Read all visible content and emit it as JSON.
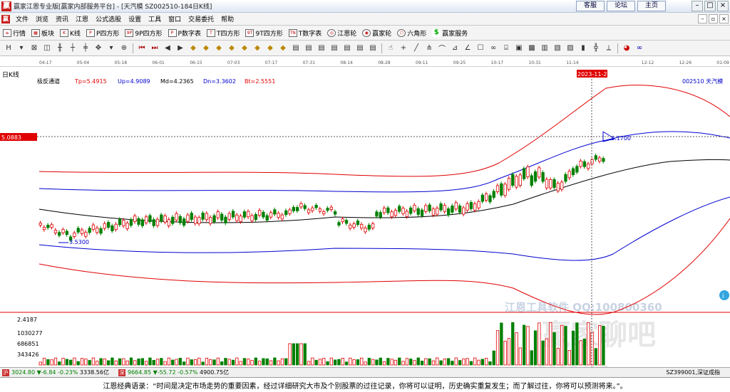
{
  "window": {
    "title": "赢家江恩专业版[赢家内部服务平台] - [天汽模  SZ002510-184日K线]",
    "links": [
      "客服",
      "论坛",
      "主页"
    ]
  },
  "menu": [
    "文件",
    "浏览",
    "资讯",
    "江恩",
    "公式选股",
    "设置",
    "工具",
    "窗口",
    "交易委托",
    "帮助"
  ],
  "toolbar1": [
    {
      "label": "行情",
      "icon": "list-icon"
    },
    {
      "label": "板块",
      "icon": "grid-icon"
    },
    {
      "label": "K线",
      "icon": "candle-icon"
    },
    {
      "label": "P四方形",
      "icon": "square-p-icon"
    },
    {
      "label": "9P四方形",
      "icon": "square-9p-icon"
    },
    {
      "label": "P数字表",
      "icon": "table-p-icon"
    },
    {
      "label": "T四方形",
      "icon": "square-t-icon"
    },
    {
      "label": "9T四方形",
      "icon": "square-9t-icon"
    },
    {
      "label": "T数字表",
      "icon": "table-t-icon"
    },
    {
      "label": "江恩轮",
      "icon": "wheel-icon"
    },
    {
      "label": "赢家轮",
      "icon": "wheel2-icon"
    },
    {
      "label": "六角形",
      "icon": "hexagon-icon"
    },
    {
      "label": "赢家服务",
      "icon": "dollar-icon"
    }
  ],
  "chart": {
    "period_label": "日K线",
    "indicator": {
      "name": "极反通道",
      "tp": "Tp=5.4915",
      "up": "Up=4.9089",
      "md": "Md=4.2365",
      "dn": "Dn=3.3602",
      "bt": "Bt=2.5551"
    },
    "stock": "002510  天汽模",
    "dates": [
      "04-17",
      "05-04",
      "05-18",
      "06-01",
      "06-15",
      "07-03",
      "07-17",
      "07-31",
      "08-14",
      "08-28",
      "09-11",
      "09-25",
      "10-17",
      "10-31",
      "11-14",
      "2023-11-23",
      "12-12",
      "12-26",
      "01-09"
    ],
    "cursor_date": "2023-11-23",
    "price_label": "5.0883",
    "high_label": "5.1700",
    "low_label": "3.5300",
    "vol_labels": [
      "2.4187",
      "1030277",
      "686851",
      "343426"
    ],
    "watermark1": "江恩工具软件  QQ:100800360",
    "watermark2": "赢家聊吧",
    "watermark3": "liaoba.vip"
  },
  "status": {
    "idx1_value": "3024.80",
    "idx1_change": "▼-6.84",
    "idx1_pct": "-0.23%",
    "idx1_amount": "3338.56亿",
    "idx2_value": "9664.85",
    "idx2_change": "▼-55.72",
    "idx2_pct": "-0.57%",
    "idx2_amount": "4900.75亿",
    "right_idx": "SZ399001,深证成指"
  },
  "quote": "江恩经典语录：“时间是决定市场走势的重要因素，经过详细研究大市及个别股票的过往记录，你将可以证明，历史确实重复发生；而了解过往，你将可以预测将来。”。",
  "colors": {
    "up": "#e00000",
    "down": "#008000",
    "channel_outer": "#e00000",
    "channel_inner": "#0000d0",
    "mid": "#000000"
  }
}
